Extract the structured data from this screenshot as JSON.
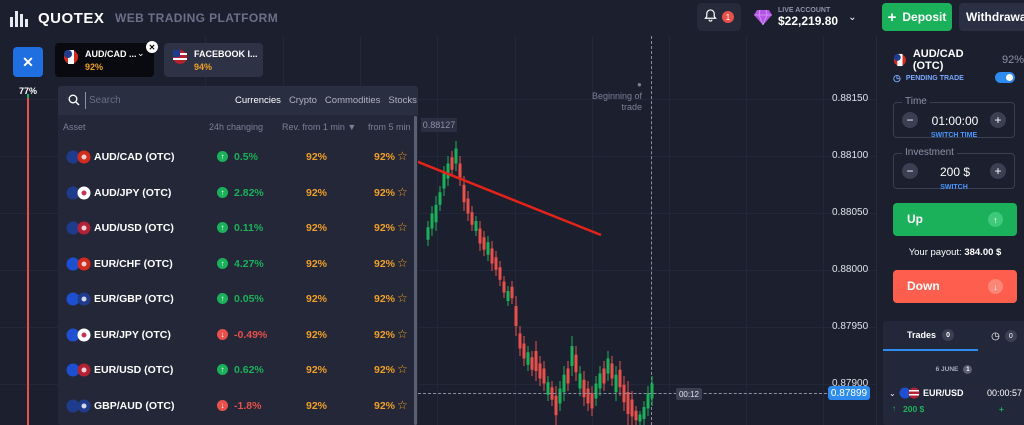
{
  "header": {
    "logo_text": "QUOTEX",
    "platform_label": "WEB TRADING PLATFORM",
    "notifications_count": "1",
    "account_label": "LIVE ACCOUNT",
    "balance": "$22,219.80",
    "deposit_label": "Deposit",
    "withdraw_label": "Withdrawal"
  },
  "tabs": [
    {
      "name": "AUD/CAD ...",
      "pct": "92%"
    },
    {
      "name": "FACEBOOK I...",
      "pct": "94%"
    }
  ],
  "sentiment": {
    "pct": "77%"
  },
  "asset_dropdown": {
    "search_placeholder": "Search",
    "categories": [
      "Currencies",
      "Crypto",
      "Commodities",
      "Stocks"
    ],
    "active_category": "Currencies",
    "columns": {
      "asset": "Asset",
      "change": "24h changing",
      "rev1": "Rev. from 1 min ▼",
      "rev5": "from 5 min"
    },
    "rows": [
      {
        "name": "AUD/CAD (OTC)",
        "change": "0.5%",
        "dir": "up",
        "rev1": "92%",
        "rev5": "92%",
        "flags": [
          "#1f3c8c",
          "#d52b1e"
        ]
      },
      {
        "name": "AUD/JPY (OTC)",
        "change": "2.82%",
        "dir": "up",
        "rev1": "92%",
        "rev5": "92%",
        "flags": [
          "#1f3c8c",
          "#ffffff"
        ]
      },
      {
        "name": "AUD/USD (OTC)",
        "change": "0.11%",
        "dir": "up",
        "rev1": "92%",
        "rev5": "92%",
        "flags": [
          "#1f3c8c",
          "#b22234"
        ]
      },
      {
        "name": "EUR/CHF (OTC)",
        "change": "4.27%",
        "dir": "up",
        "rev1": "92%",
        "rev5": "92%",
        "flags": [
          "#1f4fd1",
          "#d52b1e"
        ]
      },
      {
        "name": "EUR/GBP (OTC)",
        "change": "0.05%",
        "dir": "up",
        "rev1": "92%",
        "rev5": "92%",
        "flags": [
          "#1f4fd1",
          "#1f3c8c"
        ]
      },
      {
        "name": "EUR/JPY (OTC)",
        "change": "-0.49%",
        "dir": "down",
        "rev1": "92%",
        "rev5": "92%",
        "flags": [
          "#1f4fd1",
          "#ffffff"
        ]
      },
      {
        "name": "EUR/USD (OTC)",
        "change": "0.62%",
        "dir": "up",
        "rev1": "92%",
        "rev5": "92%",
        "flags": [
          "#1f4fd1",
          "#b22234"
        ]
      },
      {
        "name": "GBP/AUD (OTC)",
        "change": "-1.8%",
        "dir": "down",
        "rev1": "92%",
        "rev5": "92%",
        "flags": [
          "#1f3c8c",
          "#1f3c8c"
        ]
      }
    ]
  },
  "chart": {
    "price_levels": [
      "0.88150",
      "0.88100",
      "0.88050",
      "0.88000",
      "0.87950",
      "0.87900"
    ],
    "beginning_text": "Beginning of trade",
    "hover_price": "0.88127",
    "timer": "00:12",
    "current_price": "0.87899"
  },
  "right_panel": {
    "asset_name": "AUD/CAD (OTC)",
    "asset_pct": "92%",
    "pending_label": "PENDING TRADE",
    "time_legend": "Time",
    "time_value": "01:00:00",
    "switch_time_label": "SWITCH TIME",
    "investment_legend": "Investment",
    "investment_value": "200 $",
    "switch_label": "SWITCH",
    "up_label": "Up",
    "payout_label": "Your payout:",
    "payout_value": "384.00 $",
    "down_label": "Down",
    "trades_label": "Trades",
    "trades_count": "0",
    "pending_count": "0",
    "date_label": "6 JUNE",
    "date_count": "1",
    "trade": {
      "name": "EUR/USD",
      "time": "00:00:57",
      "amount": "200 $",
      "payout": "+"
    }
  },
  "colors": {
    "accent_blue": "#2e8cf0",
    "up_green": "#1bb15a",
    "down_red": "#fe5e4e",
    "payout_orange": "#f0a024"
  }
}
